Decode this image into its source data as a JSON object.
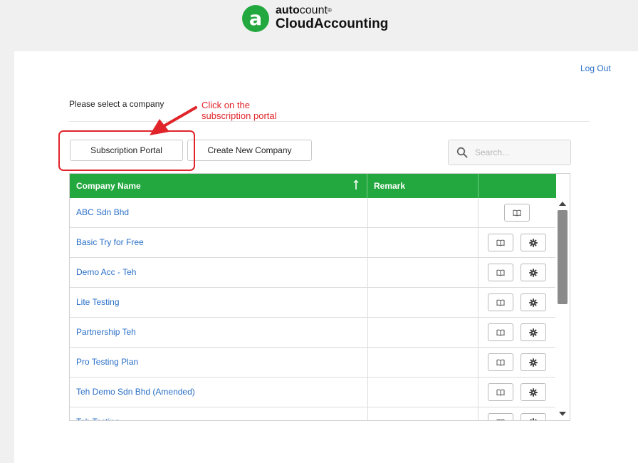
{
  "header": {
    "brand_top_bold": "auto",
    "brand_top_light": "count",
    "brand_trademark": "®",
    "brand_bottom": "CloudAccounting",
    "logo_letter": "a"
  },
  "top": {
    "logout": "Log Out",
    "prompt": "Please select a company"
  },
  "annotation": {
    "line1": "Click on the",
    "line2": "subscription portal"
  },
  "toolbar": {
    "subscription_portal": "Subscription Portal",
    "create_new_company": "Create New Company"
  },
  "search": {
    "placeholder": "Search..."
  },
  "table": {
    "headers": {
      "company_name": "Company Name",
      "remark": "Remark"
    },
    "sort": "ascending",
    "rows": [
      {
        "name": "ABC Sdn Bhd",
        "remark": "",
        "has_settings": false
      },
      {
        "name": "Basic Try for Free",
        "remark": "",
        "has_settings": true
      },
      {
        "name": "Demo Acc - Teh",
        "remark": "",
        "has_settings": true
      },
      {
        "name": "Lite Testing",
        "remark": "",
        "has_settings": true
      },
      {
        "name": "Partnership Teh",
        "remark": "",
        "has_settings": true
      },
      {
        "name": "Pro Testing Plan",
        "remark": "",
        "has_settings": true
      },
      {
        "name": "Teh Demo Sdn Bhd (Amended)",
        "remark": "",
        "has_settings": true
      },
      {
        "name": "Teh Testing",
        "remark": "",
        "has_settings": true
      }
    ]
  },
  "colors": {
    "brand_green": "#22a83e",
    "link_blue": "#2a6fc7",
    "annotation_red": "#e0242a"
  },
  "icons": {
    "open": "book-icon",
    "settings": "gear-icon",
    "search": "search-icon",
    "sort": "sort-arrow-up-icon"
  }
}
